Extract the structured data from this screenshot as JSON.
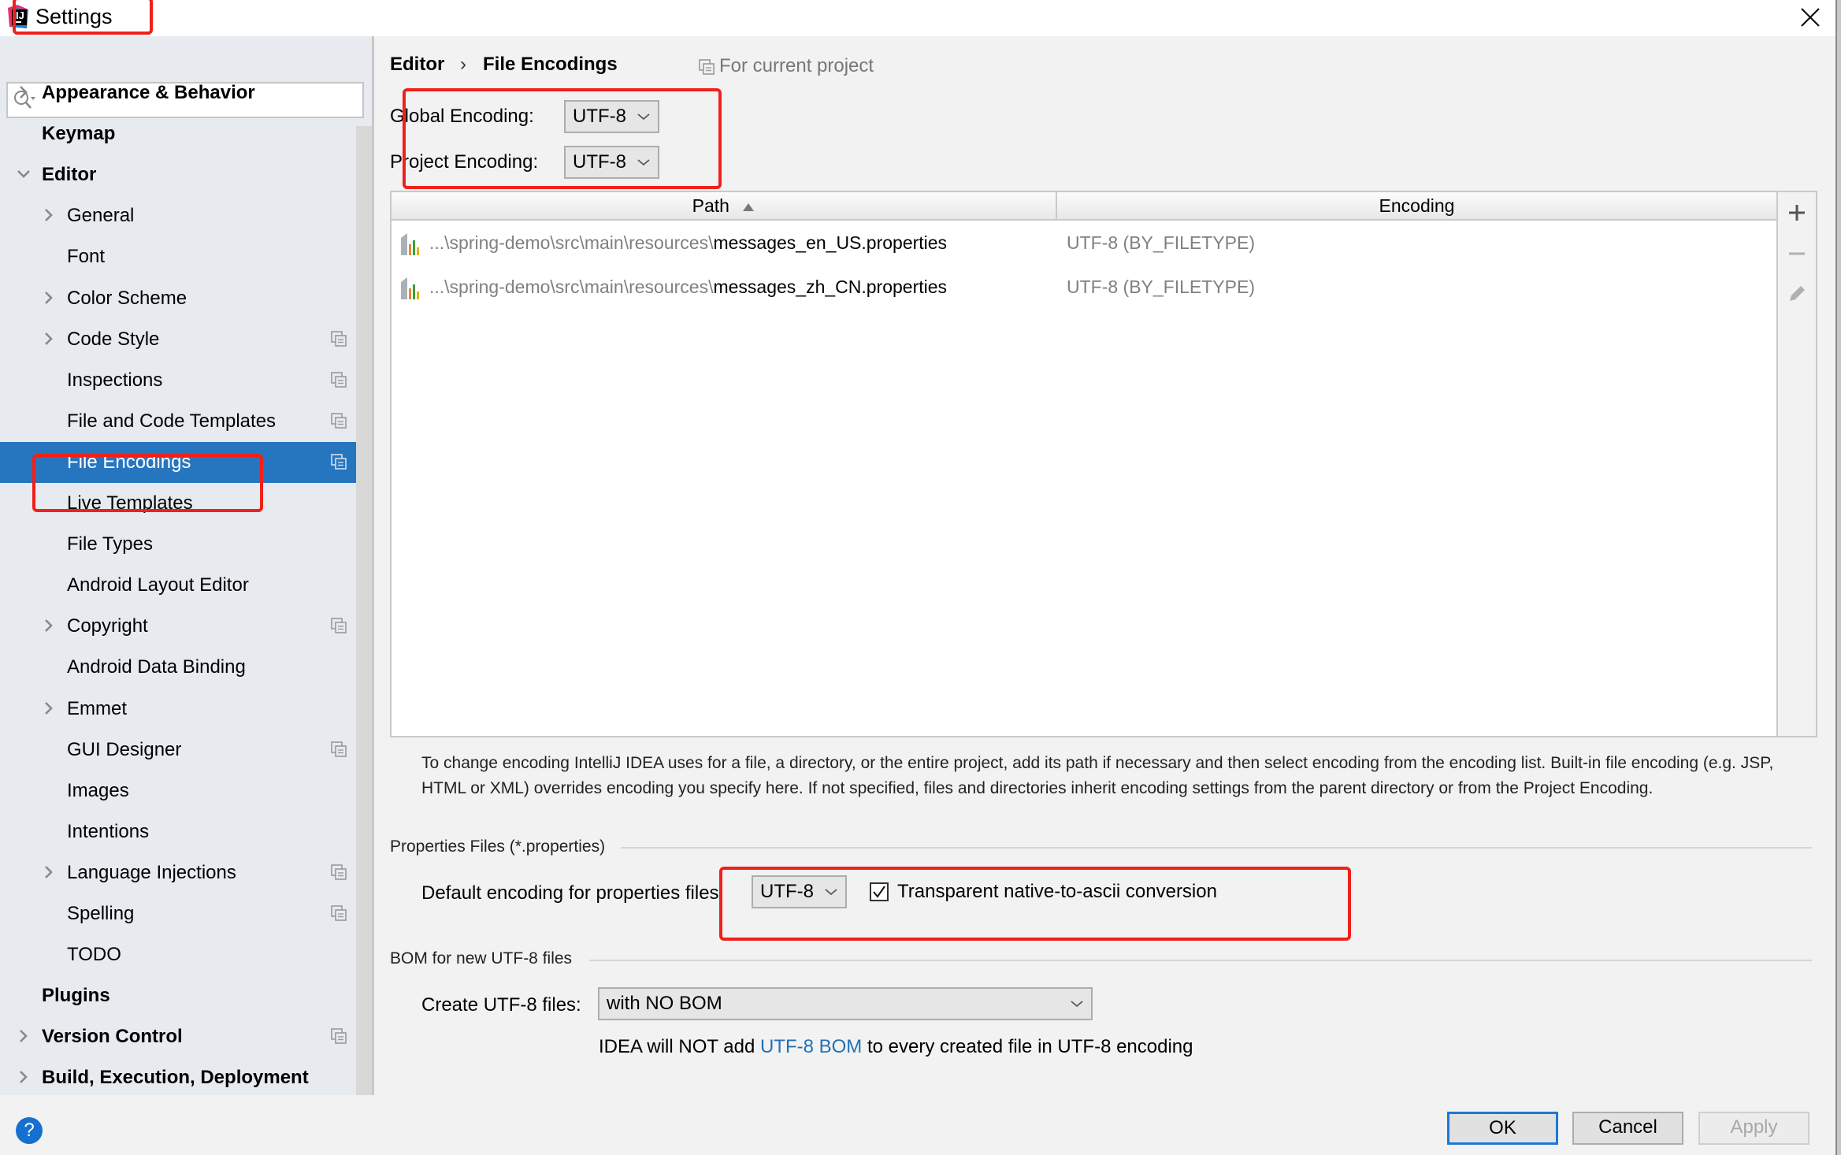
{
  "window": {
    "title": "Settings",
    "close_icon": "close-icon"
  },
  "sidebar": {
    "search": {
      "value": "",
      "placeholder": ""
    },
    "items": [
      {
        "label": "Appearance & Behavior",
        "level": 0,
        "bold": true,
        "expandable": true,
        "expanded": false,
        "project_icon": false
      },
      {
        "label": "Keymap",
        "level": 0,
        "bold": true,
        "expandable": false,
        "project_icon": false
      },
      {
        "label": "Editor",
        "level": 0,
        "bold": true,
        "expandable": true,
        "expanded": true,
        "project_icon": false
      },
      {
        "label": "General",
        "level": 1,
        "expandable": true,
        "project_icon": false
      },
      {
        "label": "Font",
        "level": 1,
        "expandable": false,
        "project_icon": false
      },
      {
        "label": "Color Scheme",
        "level": 1,
        "expandable": true,
        "project_icon": false
      },
      {
        "label": "Code Style",
        "level": 1,
        "expandable": true,
        "project_icon": true
      },
      {
        "label": "Inspections",
        "level": 1,
        "expandable": false,
        "project_icon": true
      },
      {
        "label": "File and Code Templates",
        "level": 1,
        "expandable": false,
        "project_icon": true
      },
      {
        "label": "File Encodings",
        "level": 1,
        "expandable": false,
        "project_icon": true,
        "selected": true
      },
      {
        "label": "Live Templates",
        "level": 1,
        "expandable": false,
        "project_icon": false
      },
      {
        "label": "File Types",
        "level": 1,
        "expandable": false,
        "project_icon": false
      },
      {
        "label": "Android Layout Editor",
        "level": 1,
        "expandable": false,
        "project_icon": false
      },
      {
        "label": "Copyright",
        "level": 1,
        "expandable": true,
        "project_icon": true
      },
      {
        "label": "Android Data Binding",
        "level": 1,
        "expandable": false,
        "project_icon": false
      },
      {
        "label": "Emmet",
        "level": 1,
        "expandable": true,
        "project_icon": false
      },
      {
        "label": "GUI Designer",
        "level": 1,
        "expandable": false,
        "project_icon": true
      },
      {
        "label": "Images",
        "level": 1,
        "expandable": false,
        "project_icon": false
      },
      {
        "label": "Intentions",
        "level": 1,
        "expandable": false,
        "project_icon": false
      },
      {
        "label": "Language Injections",
        "level": 1,
        "expandable": true,
        "project_icon": true
      },
      {
        "label": "Spelling",
        "level": 1,
        "expandable": false,
        "project_icon": true
      },
      {
        "label": "TODO",
        "level": 1,
        "expandable": false,
        "project_icon": false
      },
      {
        "label": "Plugins",
        "level": 0,
        "bold": true,
        "expandable": false,
        "project_icon": false
      },
      {
        "label": "Version Control",
        "level": 0,
        "bold": true,
        "expandable": true,
        "project_icon": true
      },
      {
        "label": "Build, Execution, Deployment",
        "level": 0,
        "bold": true,
        "expandable": true,
        "project_icon": false
      }
    ]
  },
  "main": {
    "breadcrumb": {
      "parent": "Editor",
      "separator": "›",
      "current": "File Encodings"
    },
    "scope_hint": "For current project",
    "global_encoding": {
      "label": "Global Encoding:",
      "value": "UTF-8"
    },
    "project_encoding": {
      "label": "Project Encoding:",
      "value": "UTF-8"
    },
    "table": {
      "columns": [
        {
          "label": "Path",
          "sort": "ascending"
        },
        {
          "label": "Encoding"
        }
      ],
      "rows": [
        {
          "path_prefix": "...\\spring-demo\\src\\main\\resources\\",
          "file": "messages_en_US.properties",
          "encoding": "UTF-8 (BY_FILETYPE)"
        },
        {
          "path_prefix": "...\\spring-demo\\src\\main\\resources\\",
          "file": "messages_zh_CN.properties",
          "encoding": "UTF-8 (BY_FILETYPE)"
        }
      ],
      "toolbar": {
        "add_icon": "plus-icon",
        "remove_icon": "minus-icon",
        "edit_icon": "pencil-icon"
      }
    },
    "help_text": "To change encoding IntelliJ IDEA uses for a file, a directory, or the entire project, add its path if necessary and then select encoding from the encoding list. Built-in file encoding (e.g. JSP, HTML or XML) overrides encoding you specify here. If not specified, files and directories inherit encoding settings from the parent directory or from the Project Encoding.",
    "properties_section": {
      "title": "Properties Files (*.properties)",
      "default_label": "Default encoding for properties files:",
      "default_value": "UTF-8",
      "native_to_ascii": {
        "label": "Transparent native-to-ascii conversion",
        "checked": true
      }
    },
    "bom_section": {
      "title": "BOM for new UTF-8 files",
      "create_label": "Create UTF-8 files:",
      "create_value": "with NO BOM",
      "note_before": "IDEA will NOT add ",
      "note_link": "UTF-8 BOM",
      "note_after": " to every created file in UTF-8 encoding"
    }
  },
  "footer": {
    "help_label": "?",
    "ok_label": "OK",
    "cancel_label": "Cancel",
    "apply_label": "Apply",
    "apply_enabled": false
  },
  "colors": {
    "selection": "#2675bf",
    "annotation_red": "#f0201a",
    "link": "#2470b3",
    "ok_border": "#1a7ad4"
  }
}
